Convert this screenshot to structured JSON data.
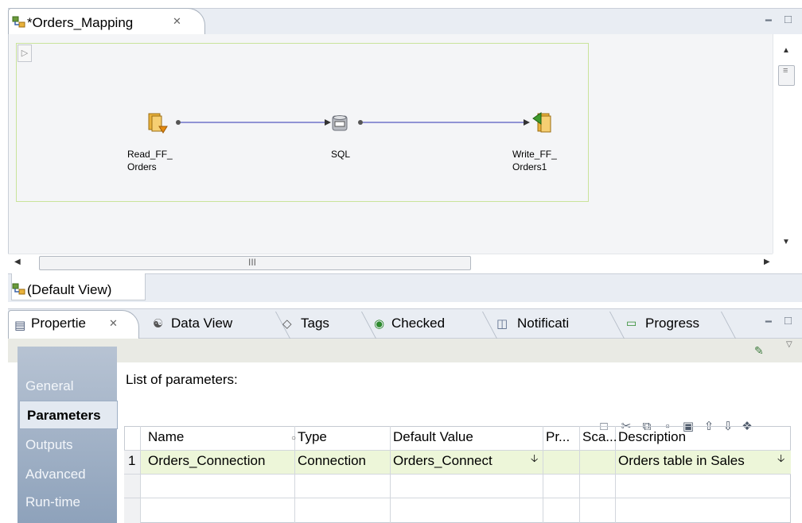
{
  "editor": {
    "tab_title": "*Orders_Mapping",
    "tab_close": "✕",
    "minimize": "━",
    "maximize": "□"
  },
  "mapping": {
    "nodes": [
      {
        "name": "read-ff-orders",
        "label_line1": "Read_FF_",
        "label_line2": "Orders",
        "icon": "source-file-icon"
      },
      {
        "name": "sql",
        "label_line1": "SQL",
        "label_line2": "",
        "icon": "sql-database-icon"
      },
      {
        "name": "write-ff-orders1",
        "label_line1": "Write_FF_",
        "label_line2": "Orders1",
        "icon": "target-file-icon"
      }
    ],
    "hscroll_mark": "III"
  },
  "view_tab": {
    "label": "(Default View)"
  },
  "properties": {
    "tabs": [
      {
        "label": "Propertie",
        "icon": "properties-icon",
        "active": true
      },
      {
        "label": "Data View",
        "icon": "data-view-icon"
      },
      {
        "label": "Tags",
        "icon": "tag-icon"
      },
      {
        "label": "Checked",
        "icon": "checked-icon"
      },
      {
        "label": "Notificati",
        "icon": "notification-icon"
      },
      {
        "label": "Progress",
        "icon": "progress-icon"
      }
    ],
    "nav": [
      "General",
      "Parameters",
      "Outputs",
      "Advanced",
      "Run-time"
    ],
    "nav_selected": "Parameters",
    "list_title": "List of parameters:",
    "columns": [
      "Name",
      "Type",
      "Default Value",
      "Pr...",
      "Sca...",
      "Description"
    ],
    "rows": [
      {
        "num": "1",
        "name": "Orders_Connection",
        "type": "Connection",
        "default": "Orders_Connect",
        "precision": "",
        "scale": "",
        "description": "Orders table in Sales"
      }
    ],
    "toolbar_icons": [
      "new-icon",
      "cut-icon",
      "copy-icon",
      "paste-icon",
      "delete-icon",
      "move-up-icon",
      "move-down-icon",
      "tag-icon"
    ]
  }
}
